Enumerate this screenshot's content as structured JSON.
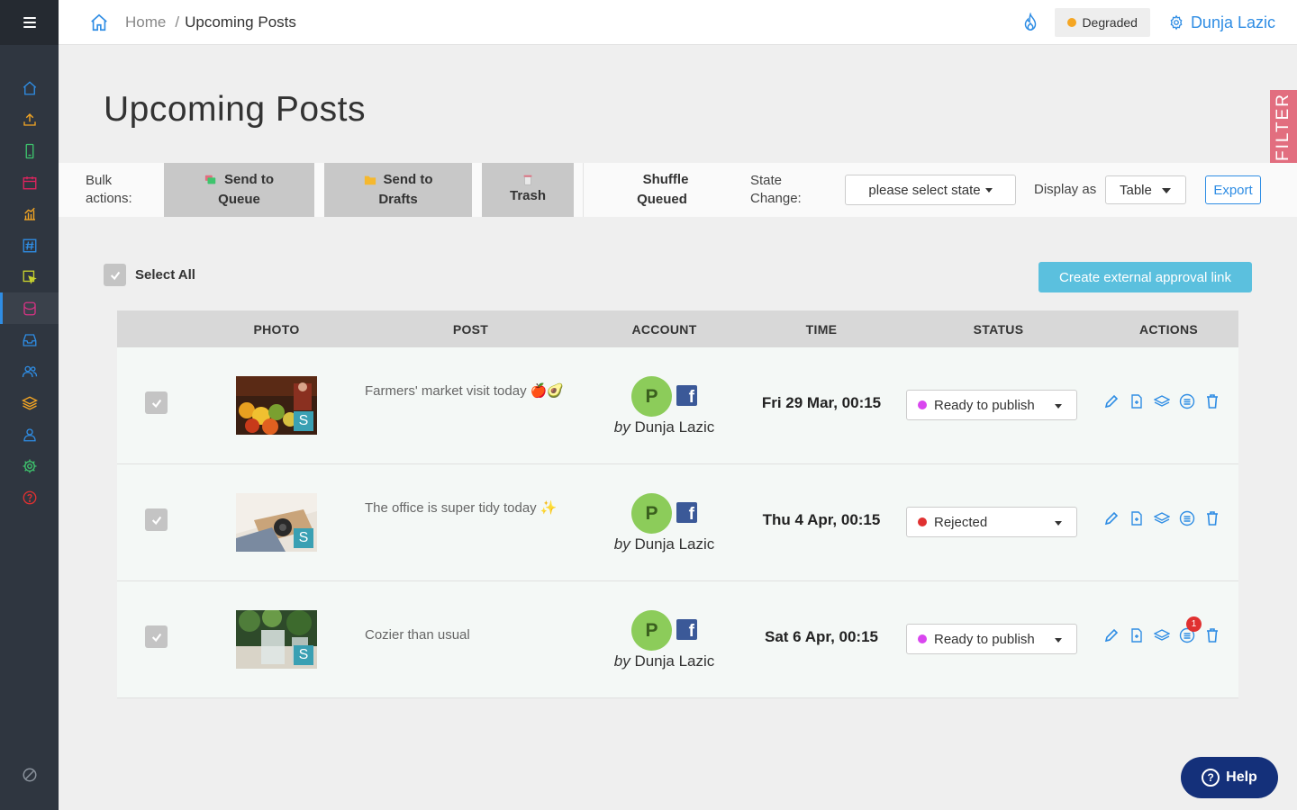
{
  "breadcrumb": {
    "home": "Home",
    "separator": "/",
    "current": "Upcoming Posts"
  },
  "header": {
    "status_text": "Degraded",
    "status_color": "#f5a623",
    "user_name": "Dunja Lazic"
  },
  "filter_tab": "FILTER",
  "page_title": "Upcoming Posts",
  "sidebar": {
    "items": [
      {
        "icon": "home-icon",
        "color": "#2f8de4"
      },
      {
        "icon": "upload-icon",
        "color": "#f5a623"
      },
      {
        "icon": "phone-icon",
        "color": "#3ec46d"
      },
      {
        "icon": "calendar-icon",
        "color": "#e0245e"
      },
      {
        "icon": "analytics-icon",
        "color": "#f5a623"
      },
      {
        "icon": "hashtag-icon",
        "color": "#2f8de4"
      },
      {
        "icon": "cursor-icon",
        "color": "#c7d12e"
      },
      {
        "icon": "inbox-heart-icon",
        "color": "#d63384"
      },
      {
        "icon": "inbox-icon",
        "color": "#2f8de4"
      },
      {
        "icon": "team-icon",
        "color": "#2f8de4"
      },
      {
        "icon": "layers-icon",
        "color": "#f5a623"
      },
      {
        "icon": "user-icon",
        "color": "#2f8de4"
      },
      {
        "icon": "settings-icon",
        "color": "#3ec46d"
      },
      {
        "icon": "help-circle-icon",
        "color": "#e03131"
      }
    ]
  },
  "bulk": {
    "label": "Bulk actions:",
    "send_queue_1": "Send to",
    "send_queue_2": "Queue",
    "send_drafts_1": "Send to",
    "send_drafts_2": "Drafts",
    "trash": "Trash",
    "shuffle_1": "Shuffle",
    "shuffle_2": "Queued",
    "state_label": "State Change:",
    "state_placeholder": "please select state",
    "display_label": "Display as",
    "display_value": "Table",
    "export": "Export"
  },
  "select_all": "Select All",
  "approval_link": "Create external approval link",
  "table": {
    "headers": [
      "PHOTO",
      "POST",
      "ACCOUNT",
      "TIME",
      "STATUS",
      "ACTIONS"
    ],
    "rows": [
      {
        "post": "Farmers' market visit today 🍎🥑",
        "avatar": "P",
        "network": "f",
        "by": "by",
        "author": "Dunja Lazic",
        "time": "Fri 29 Mar, 00:15",
        "status": "Ready to publish",
        "status_color": "#d946ef",
        "notification": ""
      },
      {
        "post": "The office is super tidy today ✨",
        "avatar": "P",
        "network": "f",
        "by": "by",
        "author": "Dunja Lazic",
        "time": "Thu 4 Apr, 00:15",
        "status": "Rejected",
        "status_color": "#e03131",
        "notification": ""
      },
      {
        "post": "Cozier than usual",
        "avatar": "P",
        "network": "f",
        "by": "by",
        "author": "Dunja Lazic",
        "time": "Sat 6 Apr, 00:15",
        "status": "Ready to publish",
        "status_color": "#d946ef",
        "notification": "1"
      }
    ],
    "photo_badge": "S"
  },
  "help": {
    "label": "Help",
    "glyph": "?"
  }
}
